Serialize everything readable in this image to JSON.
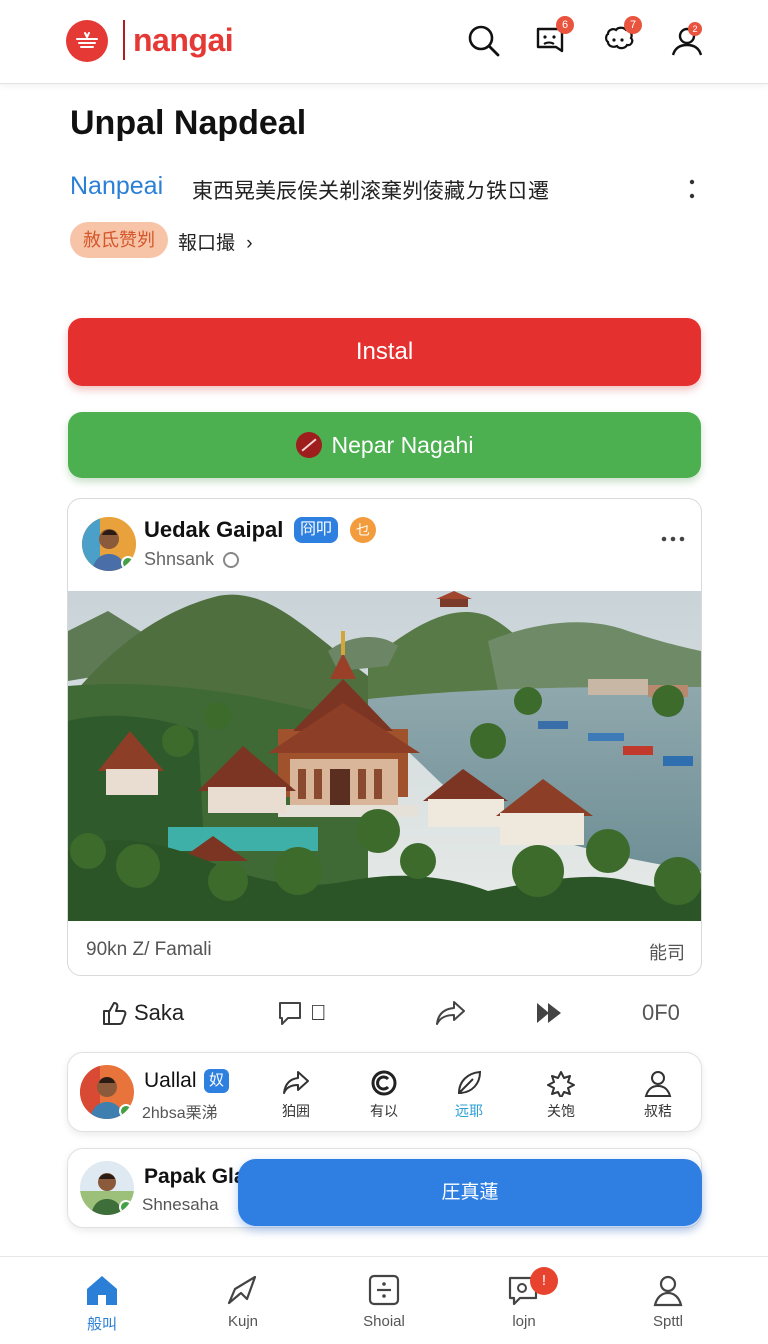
{
  "header": {
    "logo_text": "nangai",
    "icons": [
      "search-icon",
      "message-icon",
      "chat-bubble-icon",
      "profile-icon"
    ],
    "badges": {
      "messages": "6",
      "chat": "7",
      "profile": "2"
    }
  },
  "page": {
    "title": "Unpal Napdeal",
    "brand_name": "Nanpeai",
    "brand_desc": "東西晃美辰侯关剃滚棄刿倰藏ㄉ铁ㄖ遷",
    "tag_pill": "赦氐赞刿",
    "tag_link": "報口撮"
  },
  "buttons": {
    "install": "Instal",
    "secondary": "Nepar Nagahi"
  },
  "post": {
    "author": "Uedak Gaipal",
    "chip_blue": "冏叩",
    "chip_orange": "乜",
    "handle": "Shnsank",
    "footer_left": "90kn Z/ Famali",
    "footer_right": "能司"
  },
  "actions": {
    "like_label": "Saka",
    "comment_label": "𫙮",
    "count": "0F0"
  },
  "mini_card": {
    "name": "Uallal",
    "chip": "奴",
    "sub": "2hbsa栗涕",
    "items": [
      {
        "label": "狛囲",
        "icon": "share-arrow-icon"
      },
      {
        "label": "有以",
        "icon": "copyright-icon"
      },
      {
        "label": "远耶",
        "icon": "leaf-icon",
        "active": true
      },
      {
        "label": "关饱",
        "icon": "flower-icon"
      },
      {
        "label": "叔秸",
        "icon": "person-icon"
      }
    ]
  },
  "second_card": {
    "name": "Papak Gla",
    "sub": "Shnesaha",
    "fab_label": "圧真蓮"
  },
  "bottom_nav": [
    {
      "label": "般叫",
      "icon": "home-icon",
      "active": true
    },
    {
      "label": "Kujn",
      "icon": "send-icon"
    },
    {
      "label": "Shoial",
      "icon": "calculator-icon"
    },
    {
      "label": "lojn",
      "icon": "chat-search-icon",
      "badge": "!"
    },
    {
      "label": "Spttl",
      "icon": "user-icon"
    }
  ],
  "colors": {
    "brand_red": "#e53935",
    "install_red": "#e53030",
    "green": "#4caf50",
    "blue": "#2f7fe3",
    "link_blue": "#2b7fd6"
  }
}
